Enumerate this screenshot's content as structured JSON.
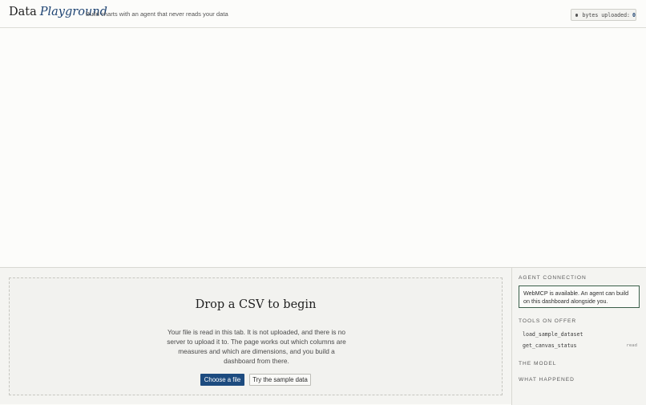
{
  "header": {
    "brand_word1": "Data",
    "brand_word2": "Playground",
    "tagline": "Build charts with an agent that never reads your data",
    "bytes_label": "bytes uploaded:",
    "bytes_count": "0"
  },
  "dropzone": {
    "title": "Drop a CSV to begin",
    "description": "Your file is read in this tab. It is not uploaded, and there is no server to upload it to. The page works out which columns are measures and which are dimensions, and you build a dashboard from there.",
    "choose_file_label": "Choose a file",
    "sample_data_label": "Try the sample data"
  },
  "sidebar": {
    "agent_connection_label": "AGENT CONNECTION",
    "notice_text": "WebMCP is available. An agent can build on this dashboard alongside you.",
    "tools_label": "TOOLS ON OFFER",
    "tools": [
      {
        "name": "load_sample_dataset",
        "tag": ""
      },
      {
        "name": "get_canvas_status",
        "tag": "read"
      }
    ],
    "model_label": "THE MODEL",
    "what_happened_label": "WHAT HAPPENED"
  },
  "colors": {
    "accent": "#1d4b7f",
    "brand_italic": "#1d4372",
    "notice_border": "#3a5e49",
    "background": "#fcfcfa"
  },
  "icons": {
    "bytes_indicator": "status-dot-icon"
  }
}
